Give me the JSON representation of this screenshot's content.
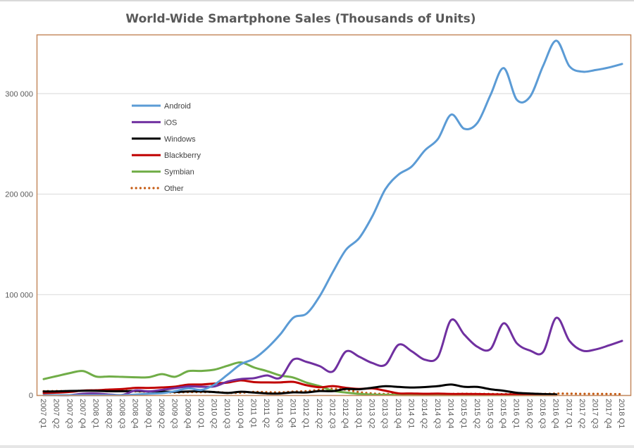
{
  "chart_data": {
    "type": "line",
    "title": "World-Wide Smartphone Sales (Thousands of Units)",
    "xlabel": "",
    "ylabel": "",
    "ylim": [
      0,
      360000
    ],
    "yticks": [
      0,
      100000,
      200000,
      300000
    ],
    "ytick_labels": [
      "0",
      "100 000",
      "200 000",
      "300 000"
    ],
    "grid": true,
    "legend_position": "top-left (inside plot)",
    "smooth": true,
    "categories": [
      "2007 Q1",
      "2007 Q2",
      "2007 Q3",
      "2007 Q4",
      "2008 Q1",
      "2008 Q2",
      "2008 Q3",
      "2008 Q4",
      "2009 Q1",
      "2009 Q2",
      "2009 Q3",
      "2009 Q4",
      "2010 Q1",
      "2010 Q2",
      "2010 Q3",
      "2010 Q4",
      "2011 Q1",
      "2011 Q2",
      "2011 Q3",
      "2011 Q4",
      "2012 Q1",
      "2012 Q2",
      "2012 Q3",
      "2012 Q4",
      "2013 Q1",
      "2013 Q2",
      "2013 Q3",
      "2013 Q4",
      "2014 Q1",
      "2014 Q2",
      "2014 Q3",
      "2014 Q4",
      "2015 Q1",
      "2015 Q2",
      "2015 Q3",
      "2015 Q4",
      "2016 Q1",
      "2016 Q2",
      "2016 Q3",
      "2016 Q4",
      "2017 Q1",
      "2017 Q2",
      "2017 Q3",
      "2017 Q4",
      "2018 Q1"
    ],
    "series": [
      {
        "name": "Android",
        "color": "#5b9bd5",
        "dash": "solid",
        "values": [
          0,
          0,
          0,
          0,
          0,
          0,
          0,
          600,
          1500,
          2000,
          4000,
          6800,
          5200,
          10600,
          20500,
          30800,
          36300,
          46800,
          60500,
          77100,
          81100,
          98500,
          122500,
          144700,
          156200,
          177900,
          205000,
          219500,
          227500,
          243500,
          255000,
          279100,
          265000,
          271000,
          298800,
          325400,
          293800,
          296900,
          327700,
          352700,
          327200,
          321800,
          323500,
          326000,
          329500
        ]
      },
      {
        "name": "iOS",
        "color": "#7030a0",
        "dash": "solid",
        "values": [
          0,
          0,
          0,
          1500,
          1700,
          700,
          300,
          4700,
          3800,
          5300,
          7000,
          8700,
          8400,
          8700,
          13500,
          16000,
          16900,
          19600,
          17300,
          35500,
          33100,
          28900,
          23600,
          43500,
          38300,
          32000,
          30300,
          50200,
          43700,
          35300,
          38200,
          74800,
          60200,
          48100,
          46000,
          71500,
          51600,
          44400,
          43000,
          77000,
          54000,
          44300,
          45500,
          49500,
          54000
        ]
      },
      {
        "name": "Windows",
        "color": "#000000",
        "dash": "solid",
        "values": [
          3700,
          3800,
          4200,
          4400,
          4300,
          3900,
          3900,
          4200,
          3700,
          3600,
          3200,
          3700,
          3700,
          3100,
          2200,
          3400,
          2600,
          1700,
          1700,
          2800,
          2700,
          4100,
          4000,
          6200,
          5900,
          7400,
          8900,
          8200,
          7600,
          8100,
          9000,
          10600,
          8300,
          8200,
          5900,
          4400,
          2400,
          1700,
          1100,
          800,
          null,
          null,
          null,
          null,
          null
        ]
      },
      {
        "name": "Blackberry",
        "color": "#c00000",
        "dash": "solid",
        "values": [
          2100,
          2500,
          3200,
          4600,
          4900,
          5600,
          6100,
          7300,
          7200,
          7700,
          8500,
          10500,
          10600,
          11600,
          12500,
          14700,
          13000,
          12700,
          12700,
          13200,
          9900,
          7900,
          9000,
          7300,
          6200,
          6700,
          4400,
          1800,
          1700,
          1400,
          1600,
          1200,
          1200,
          1100,
          900,
          700,
          700,
          400,
          300,
          200,
          null,
          null,
          null,
          null,
          null
        ]
      },
      {
        "name": "Symbian",
        "color": "#70ad47",
        "dash": "solid",
        "values": [
          16000,
          19000,
          22000,
          24000,
          18500,
          18600,
          18200,
          17800,
          17900,
          20900,
          18300,
          23900,
          24100,
          25400,
          29300,
          32600,
          27600,
          23900,
          19600,
          17500,
          12500,
          9000,
          4400,
          2600,
          1300,
          600,
          400,
          200,
          100,
          100,
          100,
          100,
          100,
          100,
          100,
          100,
          100,
          100,
          100,
          100,
          null,
          null,
          null,
          null,
          null
        ]
      },
      {
        "name": "Other",
        "color": "#c55a11",
        "dash": "dotted",
        "values": [
          4000,
          4100,
          4000,
          4500,
          4700,
          4600,
          4500,
          3800,
          3500,
          3000,
          2600,
          3100,
          3000,
          3200,
          2300,
          2400,
          3300,
          3000,
          2800,
          3600,
          4000,
          5400,
          6300,
          5400,
          3000,
          1700,
          1200,
          900,
          1000,
          900,
          900,
          1200,
          1400,
          1300,
          1200,
          1100,
          1400,
          1200,
          1300,
          1600,
          1500,
          1300,
          1300,
          1200,
          1000
        ]
      }
    ]
  }
}
